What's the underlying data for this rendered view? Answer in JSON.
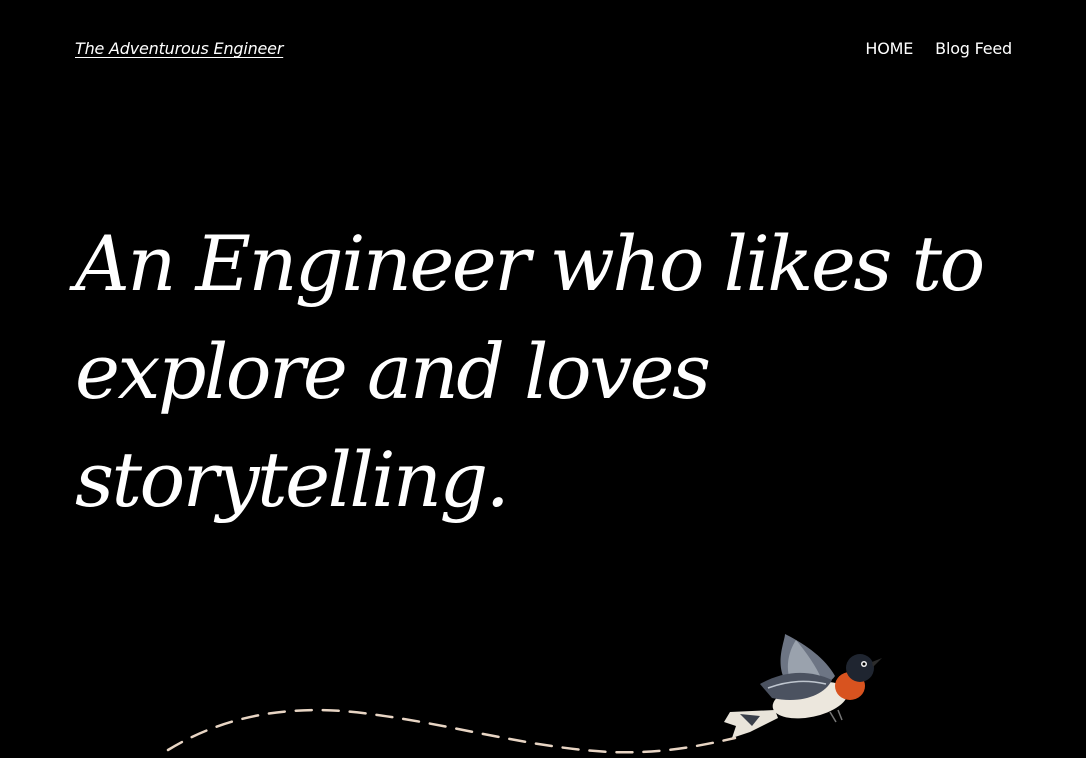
{
  "header": {
    "site_title": "The Adventurous Engineer",
    "nav": [
      {
        "label": "HOME"
      },
      {
        "label": "Blog Feed"
      }
    ]
  },
  "hero": {
    "lines": [
      "An Engineer who likes to",
      "explore and loves",
      "storytelling."
    ]
  },
  "illustration": {
    "subject": "flying-bird",
    "trail_color": "#e8d5c4"
  },
  "colors": {
    "background": "#000000",
    "text": "#ffffff"
  }
}
